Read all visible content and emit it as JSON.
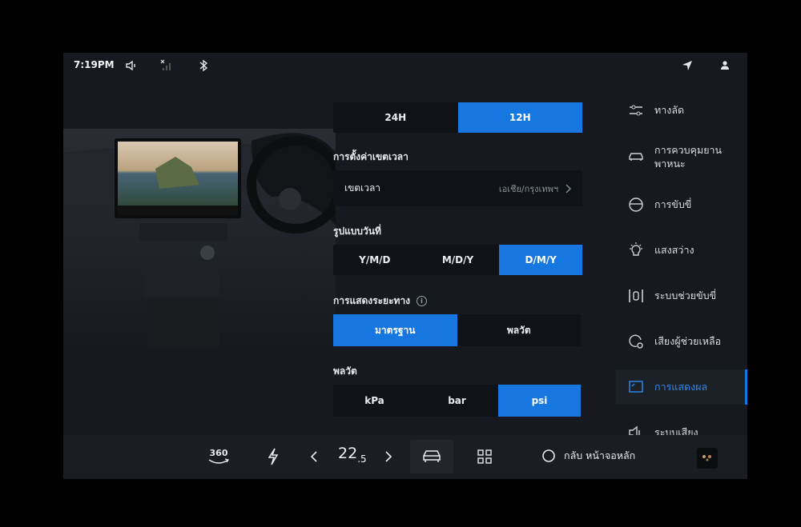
{
  "status_bar": {
    "time": "7:19PM"
  },
  "time_format": {
    "options": [
      "24H",
      "12H"
    ],
    "selected": "12H"
  },
  "timezone": {
    "section_title": "การตั้งค่าเขตเวลา",
    "label": "เขตเวลา",
    "value": "เอเชีย/กรุงเทพฯ"
  },
  "date_format": {
    "title": "รูปแบบวันที่",
    "options": [
      "Y/M/D",
      "M/D/Y",
      "D/M/Y"
    ],
    "selected": "D/M/Y"
  },
  "distance_display": {
    "title": "การแสดงระยะทาง",
    "options": [
      "มาตรฐาน",
      "พลวัต"
    ],
    "selected": "มาตรฐาน"
  },
  "pressure": {
    "title": "พลวัต",
    "options": [
      "kPa",
      "bar",
      "psi"
    ],
    "selected": "psi"
  },
  "menu": {
    "items": [
      {
        "label": "ทางลัด",
        "icon": "sliders-icon"
      },
      {
        "label": "การควบคุมยานพาหนะ",
        "icon": "car-icon"
      },
      {
        "label": "การขับขี่",
        "icon": "steering-wheel-icon"
      },
      {
        "label": "แสงสว่าง",
        "icon": "lightbulb-icon"
      },
      {
        "label": "ระบบช่วยขับขี่",
        "icon": "driver-assist-icon"
      },
      {
        "label": "เสียงผู้ช่วยเหลือ",
        "icon": "voice-assistant-icon"
      },
      {
        "label": "การแสดงผล",
        "icon": "display-icon"
      },
      {
        "label": "ระบบเสียง",
        "icon": "speaker-icon"
      }
    ],
    "active": "การแสดงผล"
  },
  "bottom_bar": {
    "camera_label": "360",
    "temperature": "22",
    "temperature_decimal": ".5",
    "back_home_label": "กลับ หน้าจอหลัก"
  },
  "colors": {
    "accent": "#1677e0",
    "background": "#16191f",
    "panel": "#0f1217"
  }
}
